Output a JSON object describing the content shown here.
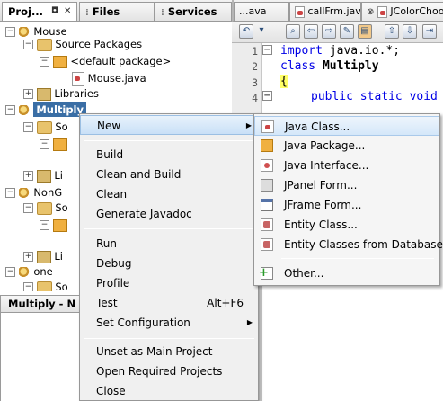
{
  "left_tabs": {
    "projects": "Proj...",
    "files": "Files",
    "services": "Services"
  },
  "tree": {
    "rows": [
      {
        "label": "Mouse"
      },
      {
        "label": "Source Packages"
      },
      {
        "label": "<default package>"
      },
      {
        "label": "Mouse.java"
      },
      {
        "label": "Libraries"
      },
      {
        "label": "Multiply"
      },
      {
        "label": "So"
      },
      {
        "label": "Li"
      },
      {
        "label": "NonG"
      },
      {
        "label": "So"
      },
      {
        "label": "Li"
      },
      {
        "label": "one"
      },
      {
        "label": "So"
      }
    ]
  },
  "navigator": {
    "title": "Multiply - N"
  },
  "editor_tabs": {
    "tab1": "...ava",
    "tab2": "callFrm.java",
    "tab3": "JColorChoose"
  },
  "code": {
    "line_numbers": [
      "1",
      "2",
      "3",
      "4"
    ],
    "line1_kw": "import",
    "line1_rest": " java.io.*;",
    "line2_kw": "class",
    "line2_rest": " Multiply",
    "line3": "{",
    "line4_kw": "public static void"
  },
  "context_menu": {
    "new": "New",
    "build": "Build",
    "clean_build": "Clean and Build",
    "clean": "Clean",
    "javadoc": "Generate Javadoc",
    "run": "Run",
    "debug": "Debug",
    "profile": "Profile",
    "test": "Test",
    "test_shortcut": "Alt+F6",
    "set_config": "Set Configuration",
    "unset_main": "Unset as Main Project",
    "open_required": "Open Required Projects",
    "close": "Close"
  },
  "submenu": {
    "java_class": "Java Class...",
    "java_package": "Java Package...",
    "java_interface": "Java Interface...",
    "jpanel_form": "JPanel Form...",
    "jframe_form": "JFrame Form...",
    "entity_class": "Entity Class...",
    "entity_classes_db": "Entity Classes from Database...",
    "other": "Other..."
  }
}
